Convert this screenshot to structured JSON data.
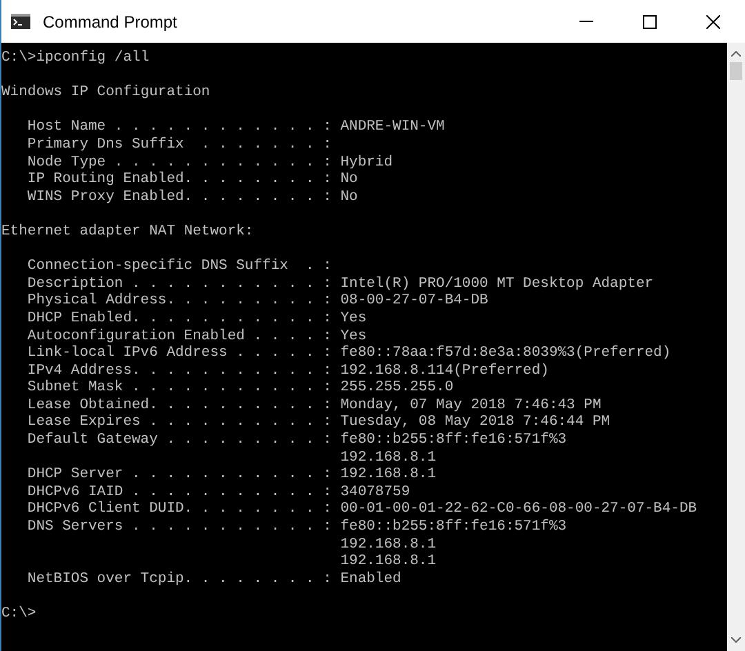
{
  "window": {
    "title": "Command Prompt"
  },
  "console": {
    "blocks": [
      {
        "kind": "plain",
        "lines": [
          "C:\\>ipconfig /all"
        ]
      },
      {
        "kind": "plain",
        "lines": [
          "Windows IP Configuration"
        ]
      },
      {
        "kind": "entries",
        "entries": [
          {
            "label": "Host Name . . . . . . . . . . . . :",
            "values": [
              "ANDRE-WIN-VM"
            ]
          },
          {
            "label": "Primary Dns Suffix  . . . . . . . :"
          },
          {
            "label": "Node Type . . . . . . . . . . . . :",
            "values": [
              "Hybrid"
            ]
          },
          {
            "label": "IP Routing Enabled. . . . . . . . :",
            "values": [
              "No"
            ]
          },
          {
            "label": "WINS Proxy Enabled. . . . . . . . :",
            "values": [
              "No"
            ]
          }
        ]
      },
      {
        "kind": "plain",
        "lines": [
          "Ethernet adapter NAT Network:"
        ]
      },
      {
        "kind": "entries",
        "entries": [
          {
            "label": "Connection-specific DNS Suffix  . :"
          },
          {
            "label": "Description . . . . . . . . . . . :",
            "values": [
              "Intel(R) PRO/1000 MT Desktop Adapter"
            ]
          },
          {
            "label": "Physical Address. . . . . . . . . :",
            "values": [
              "08-00-27-07-B4-DB"
            ]
          },
          {
            "label": "DHCP Enabled. . . . . . . . . . . :",
            "values": [
              "Yes"
            ]
          },
          {
            "label": "Autoconfiguration Enabled . . . . :",
            "values": [
              "Yes"
            ]
          },
          {
            "label": "Link-local IPv6 Address . . . . . :",
            "values": [
              "fe80::78aa:f57d:8e3a:8039%3(Preferred)"
            ]
          },
          {
            "label": "IPv4 Address. . . . . . . . . . . :",
            "values": [
              "192.168.8.114(Preferred)"
            ]
          },
          {
            "label": "Subnet Mask . . . . . . . . . . . :",
            "values": [
              "255.255.255.0"
            ]
          },
          {
            "label": "Lease Obtained. . . . . . . . . . :",
            "values": [
              "Monday, 07 May 2018 7:46:43 PM"
            ]
          },
          {
            "label": "Lease Expires . . . . . . . . . . :",
            "values": [
              "Tuesday, 08 May 2018 7:46:44 PM"
            ]
          },
          {
            "label": "Default Gateway . . . . . . . . . :",
            "values": [
              "fe80::b255:8ff:fe16:571f%3",
              "192.168.8.1"
            ]
          },
          {
            "label": "DHCP Server . . . . . . . . . . . :",
            "values": [
              "192.168.8.1"
            ]
          },
          {
            "label": "DHCPv6 IAID . . . . . . . . . . . :",
            "values": [
              "34078759"
            ]
          },
          {
            "label": "DHCPv6 Client DUID. . . . . . . . :",
            "values": [
              "00-01-00-01-22-62-C0-66-08-00-27-07-B4-DB"
            ]
          },
          {
            "label": "DNS Servers . . . . . . . . . . . :",
            "values": [
              "fe80::b255:8ff:fe16:571f%3",
              "192.168.8.1",
              "192.168.8.1"
            ]
          },
          {
            "label": "NetBIOS over Tcpip. . . . . . . . :",
            "values": [
              "Enabled"
            ]
          }
        ]
      },
      {
        "kind": "plain",
        "lines": [
          "C:\\>"
        ]
      }
    ]
  }
}
